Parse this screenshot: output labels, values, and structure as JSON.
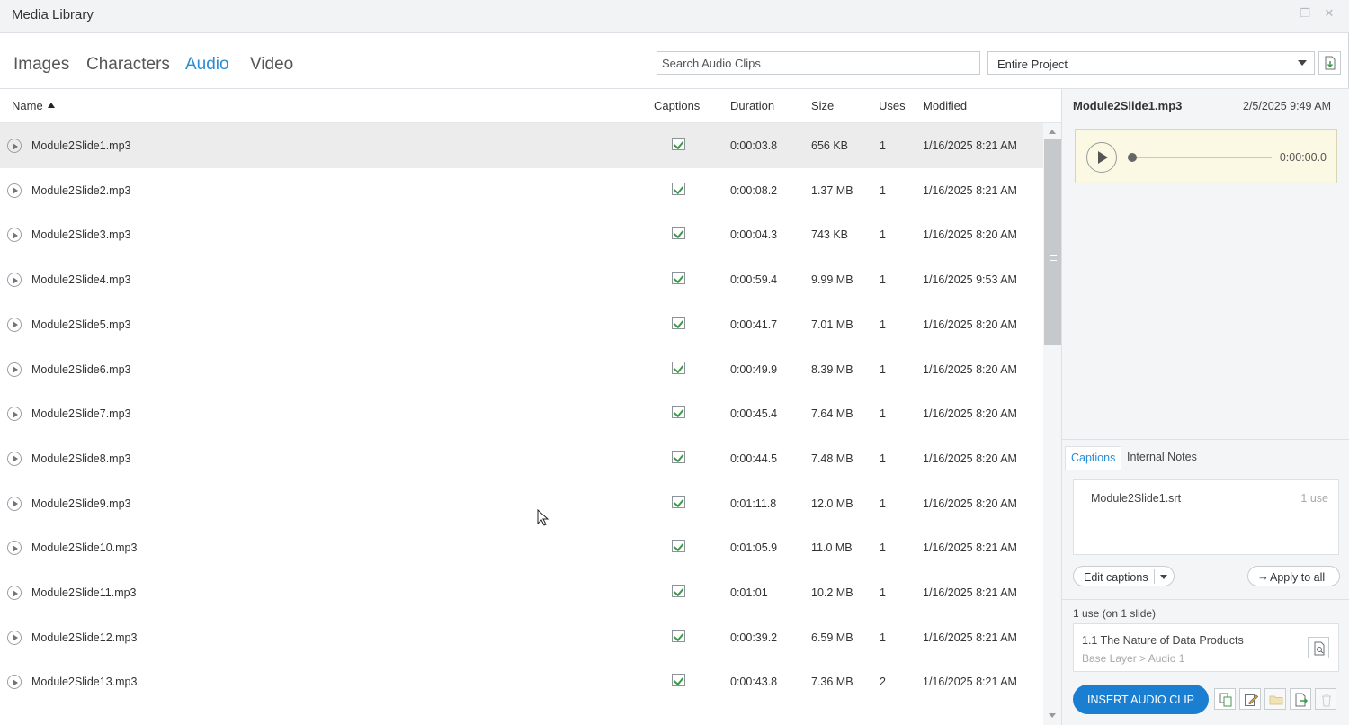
{
  "window": {
    "title": "Media Library"
  },
  "tabs": [
    {
      "label": "Images"
    },
    {
      "label": "Characters"
    },
    {
      "label": "Audio"
    },
    {
      "label": "Video"
    }
  ],
  "active_tab": "Audio",
  "search": {
    "placeholder": "Search Audio Clips",
    "value": ""
  },
  "scope": {
    "selected": "Entire Project"
  },
  "columns": {
    "name": "Name",
    "captions": "Captions",
    "duration": "Duration",
    "size": "Size",
    "uses": "Uses",
    "modified": "Modified"
  },
  "sort": {
    "column": "Name",
    "direction": "ascending"
  },
  "rows": [
    {
      "name": "Module2Slide1.mp3",
      "captions": true,
      "duration": "0:00:03.8",
      "size": "656 KB",
      "uses": "1",
      "modified": "1/16/2025 8:21 AM",
      "selected": true
    },
    {
      "name": "Module2Slide2.mp3",
      "captions": true,
      "duration": "0:00:08.2",
      "size": "1.37 MB",
      "uses": "1",
      "modified": "1/16/2025 8:21 AM"
    },
    {
      "name": "Module2Slide3.mp3",
      "captions": true,
      "duration": "0:00:04.3",
      "size": "743 KB",
      "uses": "1",
      "modified": "1/16/2025 8:20 AM"
    },
    {
      "name": "Module2Slide4.mp3",
      "captions": true,
      "duration": "0:00:59.4",
      "size": "9.99 MB",
      "uses": "1",
      "modified": "1/16/2025 9:53 AM"
    },
    {
      "name": "Module2Slide5.mp3",
      "captions": true,
      "duration": "0:00:41.7",
      "size": "7.01 MB",
      "uses": "1",
      "modified": "1/16/2025 8:20 AM"
    },
    {
      "name": "Module2Slide6.mp3",
      "captions": true,
      "duration": "0:00:49.9",
      "size": "8.39 MB",
      "uses": "1",
      "modified": "1/16/2025 8:20 AM"
    },
    {
      "name": "Module2Slide7.mp3",
      "captions": true,
      "duration": "0:00:45.4",
      "size": "7.64 MB",
      "uses": "1",
      "modified": "1/16/2025 8:20 AM"
    },
    {
      "name": "Module2Slide8.mp3",
      "captions": true,
      "duration": "0:00:44.5",
      "size": "7.48 MB",
      "uses": "1",
      "modified": "1/16/2025 8:20 AM"
    },
    {
      "name": "Module2Slide9.mp3",
      "captions": true,
      "duration": "0:01:11.8",
      "size": "12.0 MB",
      "uses": "1",
      "modified": "1/16/2025 8:20 AM"
    },
    {
      "name": "Module2Slide10.mp3",
      "captions": true,
      "duration": "0:01:05.9",
      "size": "11.0 MB",
      "uses": "1",
      "modified": "1/16/2025 8:21 AM"
    },
    {
      "name": "Module2Slide11.mp3",
      "captions": true,
      "duration": "0:01:01",
      "size": "10.2 MB",
      "uses": "1",
      "modified": "1/16/2025 8:21 AM"
    },
    {
      "name": "Module2Slide12.mp3",
      "captions": true,
      "duration": "0:00:39.2",
      "size": "6.59 MB",
      "uses": "1",
      "modified": "1/16/2025 8:21 AM"
    },
    {
      "name": "Module2Slide13.mp3",
      "captions": true,
      "duration": "0:00:43.8",
      "size": "7.36 MB",
      "uses": "2",
      "modified": "1/16/2025 8:21 AM"
    }
  ],
  "details": {
    "file_name": "Module2Slide1.mp3",
    "date": "2/5/2025 9:49 AM",
    "player": {
      "time": "0:00:00.0",
      "progress": 0
    },
    "subtabs": [
      {
        "label": "Captions"
      },
      {
        "label": "Internal Notes"
      }
    ],
    "active_subtab": "Captions",
    "caption_file": {
      "name": "Module2Slide1.srt",
      "uses": "1 use"
    },
    "edit_captions_label": "Edit captions",
    "apply_all_label": "Apply to all",
    "apply_all_arrow": "→",
    "usage_summary": "1 use (on 1 slide)",
    "usage": {
      "title": "1.1 The Nature of Data Products",
      "path": "Base Layer > Audio 1"
    },
    "insert_label": "INSERT AUDIO CLIP"
  },
  "icons": {
    "window": [
      "restore-icon",
      "close-icon"
    ],
    "restore_glyph": "❐",
    "close_glyph": "✕",
    "toolbar": [
      "import-file-icon"
    ],
    "bottom": [
      "copy-icon",
      "edit-icon",
      "open-folder-icon",
      "export-icon",
      "delete-icon"
    ]
  },
  "colors": {
    "accent": "#2a8dd4",
    "insert_button": "#1b7fd1",
    "player_bg": "#fbf9e3",
    "check": "#3d9a4b",
    "selected_row": "#ececec"
  }
}
